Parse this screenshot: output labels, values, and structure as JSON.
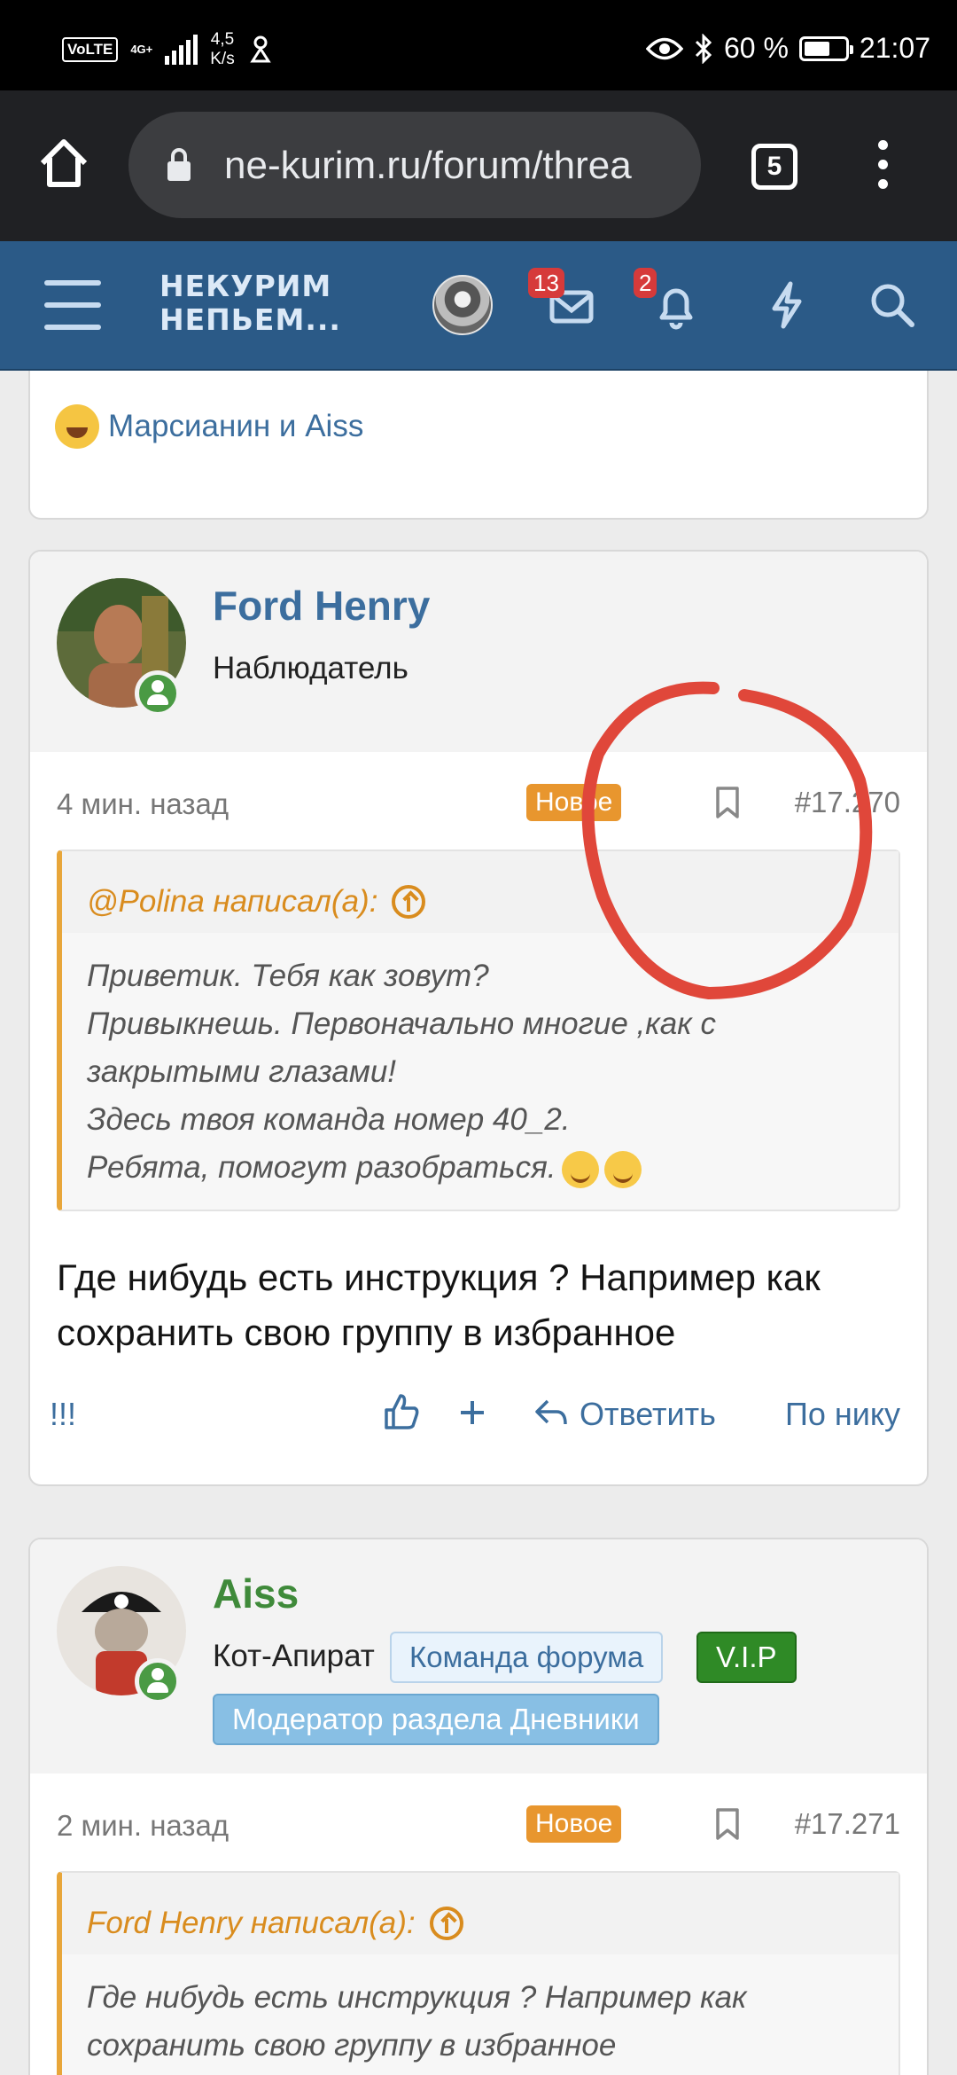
{
  "status_bar": {
    "volte": "VoLTE",
    "network": "4G+",
    "speed_value": "4,5",
    "speed_unit": "K/s",
    "battery_percent": "60 %",
    "time": "21:07"
  },
  "browser": {
    "url": "ne-kurim.ru/forum/threa",
    "tab_count": "5"
  },
  "site_header": {
    "logo_line1": "НЕКУРИМ",
    "logo_line2": "НЕПЬЕМ...",
    "messages_count": "13",
    "alerts_count": "2"
  },
  "prev_post": {
    "reactions_names": "Марсианин и Aiss"
  },
  "post1": {
    "username": "Ford Henry",
    "user_title": "Наблюдатель",
    "time": "4 мин. назад",
    "new_label": "Новое",
    "post_number": "#17.270",
    "quote_author": "@Polina написал(а):",
    "quote_lines": [
      "Приветик. Тебя как зовут?",
      "Привыкнешь. Первоначально многие ,как с",
      "закрытыми глазами!",
      "Здесь твоя команда номер 40_2.",
      "Ребята, помогут разобраться."
    ],
    "text": "Где нибудь есть инструкция ? Например как сохранить свою группу в избранное",
    "actions": {
      "extra": "!!!",
      "reply": "Ответить",
      "by_nick": "По нику"
    }
  },
  "post2": {
    "username": "Aiss",
    "user_title": "Кот-Апират",
    "tags": [
      "Команда форума",
      "V.I.P",
      "Модератор раздела Дневники"
    ],
    "time": "2 мин. назад",
    "new_label": "Новое",
    "post_number": "#17.271",
    "quote_author": "Ford Henry написал(а):",
    "quote_lines": [
      "Где нибудь есть инструкция ? Например как",
      "сохранить свою группу в избранное"
    ]
  },
  "colors": {
    "header_bg": "#2b5a87",
    "link": "#3c6e9e",
    "new_badge": "#e8962e",
    "annotation": "#e0473a"
  }
}
